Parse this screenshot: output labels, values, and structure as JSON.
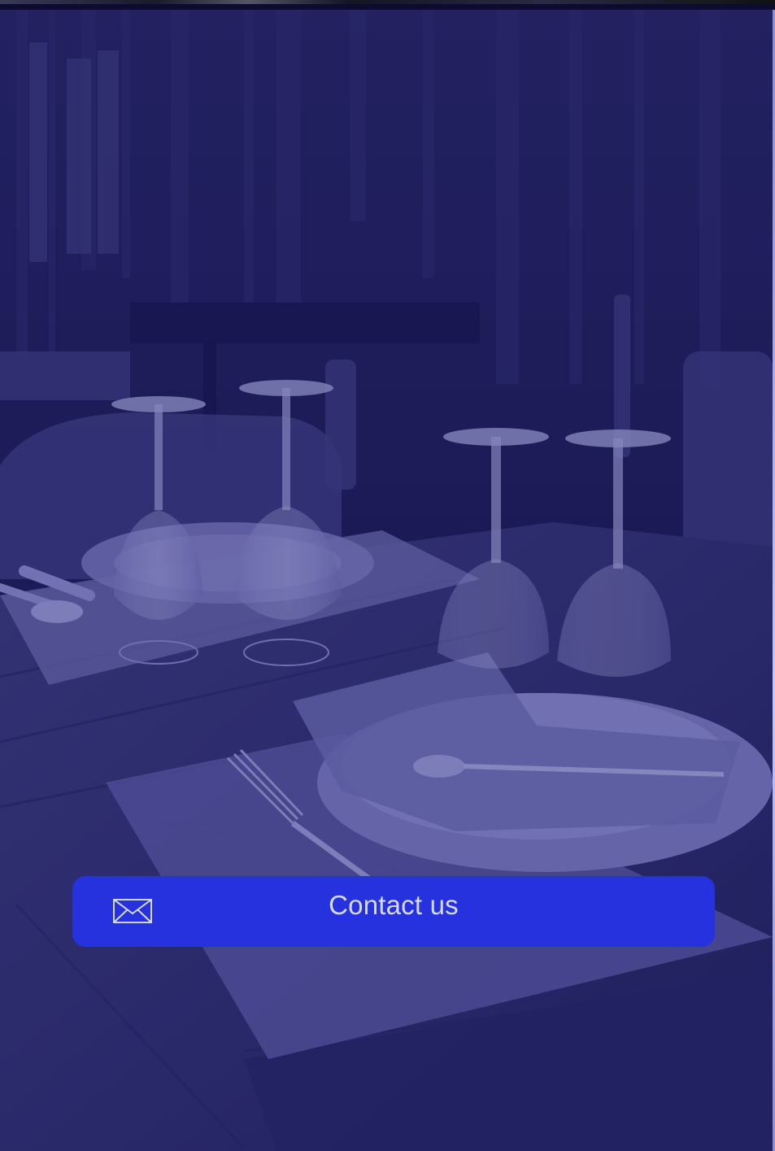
{
  "scene": {
    "background_image": "restaurant-table-setting",
    "overlay_color": "#1f1e66"
  },
  "contact_button": {
    "label": "Contact us",
    "icon": "envelope-icon",
    "background_color": "#2532dd",
    "text_color": "#d7daf6"
  }
}
